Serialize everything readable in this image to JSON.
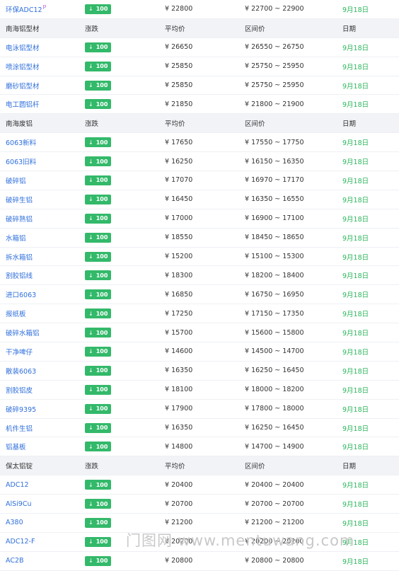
{
  "colors": {
    "accent_green": "#33b96a",
    "date_green": "#2cb65c",
    "link_blue": "#2f6fdc",
    "header_bg": "#f2f3f7"
  },
  "change_icon": "arrow-down-icon",
  "watermark": "门图网 www.mentuwang.com",
  "rows": [
    {
      "type": "data",
      "name": "环保ADC12",
      "tag": "P",
      "change": "100",
      "avg": "¥ 22800",
      "range": "¥ 22700 ~ 22900",
      "date": "9月18日"
    },
    {
      "type": "header",
      "name": "南海铝型材",
      "change": "涨跌",
      "avg": "平均价",
      "range": "区间价",
      "date": "日期"
    },
    {
      "type": "data",
      "name": "电泳铝型材",
      "change": "100",
      "avg": "¥ 26650",
      "range": "¥ 26550 ~ 26750",
      "date": "9月18日"
    },
    {
      "type": "data",
      "name": "喷涂铝型材",
      "change": "100",
      "avg": "¥ 25850",
      "range": "¥ 25750 ~ 25950",
      "date": "9月18日"
    },
    {
      "type": "data",
      "name": "磨砂铝型材",
      "change": "100",
      "avg": "¥ 25850",
      "range": "¥ 25750 ~ 25950",
      "date": "9月18日"
    },
    {
      "type": "data",
      "name": "电工圆铝杆",
      "change": "100",
      "avg": "¥ 21850",
      "range": "¥ 21800 ~ 21900",
      "date": "9月18日"
    },
    {
      "type": "header",
      "name": "南海废铝",
      "change": "涨跌",
      "avg": "平均价",
      "range": "区间价",
      "date": "日期"
    },
    {
      "type": "data",
      "name": "6063新料",
      "change": "100",
      "avg": "¥ 17650",
      "range": "¥ 17550 ~ 17750",
      "date": "9月18日"
    },
    {
      "type": "data",
      "name": "6063旧料",
      "change": "100",
      "avg": "¥ 16250",
      "range": "¥ 16150 ~ 16350",
      "date": "9月18日"
    },
    {
      "type": "data",
      "name": "破碎铝",
      "change": "100",
      "avg": "¥ 17070",
      "range": "¥ 16970 ~ 17170",
      "date": "9月18日"
    },
    {
      "type": "data",
      "name": "破碎生铝",
      "change": "100",
      "avg": "¥ 16450",
      "range": "¥ 16350 ~ 16550",
      "date": "9月18日"
    },
    {
      "type": "data",
      "name": "破碎熟铝",
      "change": "100",
      "avg": "¥ 17000",
      "range": "¥ 16900 ~ 17100",
      "date": "9月18日"
    },
    {
      "type": "data",
      "name": "水箱铝",
      "change": "100",
      "avg": "¥ 18550",
      "range": "¥ 18450 ~ 18650",
      "date": "9月18日"
    },
    {
      "type": "data",
      "name": "拆水箱铝",
      "change": "100",
      "avg": "¥ 15200",
      "range": "¥ 15100 ~ 15300",
      "date": "9月18日"
    },
    {
      "type": "data",
      "name": "割胶铝线",
      "change": "100",
      "avg": "¥ 18300",
      "range": "¥ 18200 ~ 18400",
      "date": "9月18日"
    },
    {
      "type": "data",
      "name": "进口6063",
      "change": "100",
      "avg": "¥ 16850",
      "range": "¥ 16750 ~ 16950",
      "date": "9月18日"
    },
    {
      "type": "data",
      "name": "报纸板",
      "change": "100",
      "avg": "¥ 17250",
      "range": "¥ 17150 ~ 17350",
      "date": "9月18日"
    },
    {
      "type": "data",
      "name": "破碎水箱铝",
      "change": "100",
      "avg": "¥ 15700",
      "range": "¥ 15600 ~ 15800",
      "date": "9月18日"
    },
    {
      "type": "data",
      "name": "干净啤仔",
      "change": "100",
      "avg": "¥ 14600",
      "range": "¥ 14500 ~ 14700",
      "date": "9月18日"
    },
    {
      "type": "data",
      "name": "散装6063",
      "change": "100",
      "avg": "¥ 16350",
      "range": "¥ 16250 ~ 16450",
      "date": "9月18日"
    },
    {
      "type": "data",
      "name": "割胶铝皮",
      "change": "100",
      "avg": "¥ 18100",
      "range": "¥ 18000 ~ 18200",
      "date": "9月18日"
    },
    {
      "type": "data",
      "name": "破碎9395",
      "change": "100",
      "avg": "¥ 17900",
      "range": "¥ 17800 ~ 18000",
      "date": "9月18日"
    },
    {
      "type": "data",
      "name": "机件生铝",
      "change": "100",
      "avg": "¥ 16350",
      "range": "¥ 16250 ~ 16450",
      "date": "9月18日"
    },
    {
      "type": "data",
      "name": "铝基板",
      "change": "100",
      "avg": "¥ 14800",
      "range": "¥ 14700 ~ 14900",
      "date": "9月18日"
    },
    {
      "type": "header",
      "name": "保太铝锭",
      "change": "涨跌",
      "avg": "平均价",
      "range": "区间价",
      "date": "日期"
    },
    {
      "type": "data",
      "name": "ADC12",
      "change": "100",
      "avg": "¥ 20400",
      "range": "¥ 20400 ~ 20400",
      "date": "9月18日"
    },
    {
      "type": "data",
      "name": "AlSi9Cu",
      "change": "100",
      "avg": "¥ 20700",
      "range": "¥ 20700 ~ 20700",
      "date": "9月18日"
    },
    {
      "type": "data",
      "name": "A380",
      "change": "100",
      "avg": "¥ 21200",
      "range": "¥ 21200 ~ 21200",
      "date": "9月18日"
    },
    {
      "type": "data",
      "name": "ADC12-F",
      "change": "100",
      "avg": "¥ 20200",
      "range": "¥ 20200 ~ 20200",
      "date": "9月18日"
    },
    {
      "type": "data",
      "name": "AC2B",
      "change": "100",
      "avg": "¥ 20800",
      "range": "¥ 20800 ~ 20800",
      "date": "9月18日"
    }
  ]
}
